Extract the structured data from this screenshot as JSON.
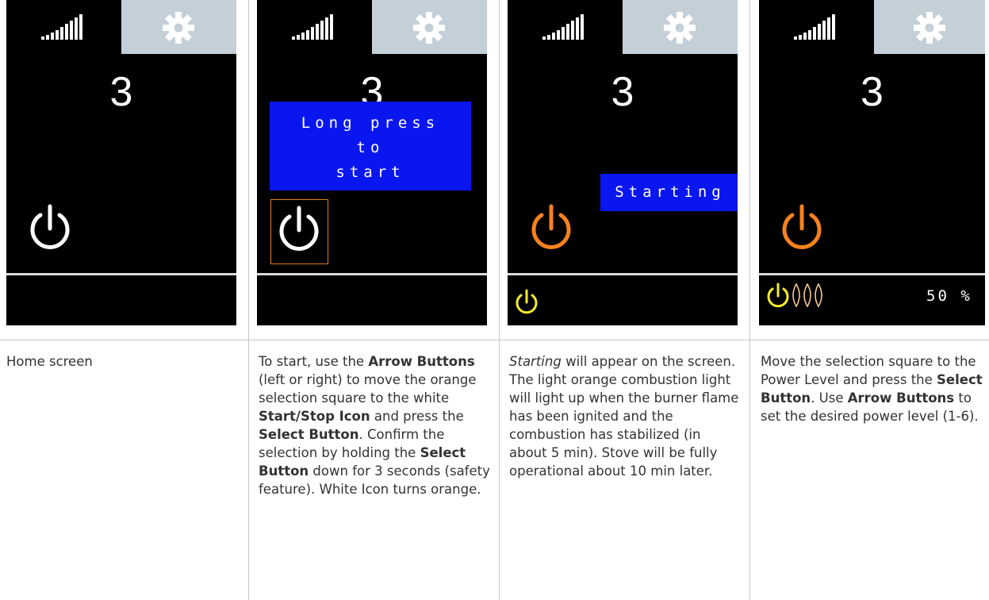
{
  "screens": [
    {
      "level": "3",
      "message": "",
      "power_icon_color": "#ffffff",
      "status_icons": []
    },
    {
      "level": "3",
      "message_lines": [
        "Long press",
        "to",
        "start"
      ],
      "power_icon_color": "#ffffff",
      "selection_color": "#e07e1f"
    },
    {
      "level": "3",
      "message": "Starting",
      "power_icon_color": "#f6821f",
      "status_power_color": "#f7ec2b"
    },
    {
      "level": "3",
      "power_icon_color": "#f6821f",
      "status_power_color": "#f7ec2b",
      "flame_color": "#f3c98f",
      "power_percent": "50 %"
    }
  ],
  "captions": [
    {
      "parts": [
        {
          "text": "Home screen",
          "bold": false,
          "italic": false
        }
      ]
    },
    {
      "parts": [
        {
          "text": "To start, use the ",
          "bold": false
        },
        {
          "text": "Arrow Buttons",
          "bold": true
        },
        {
          "text": " (left or right) to move the orange selection square to the white ",
          "bold": false
        },
        {
          "text": "Start/Stop Icon",
          "bold": true
        },
        {
          "text": " and press the ",
          "bold": false
        },
        {
          "text": "Select Button",
          "bold": true
        },
        {
          "text": ". Confirm the selection by holding the ",
          "bold": false
        },
        {
          "text": "Select Button",
          "bold": true
        },
        {
          "text": " down for 3 seconds (safety feature). White Icon turns orange.",
          "bold": false
        }
      ]
    },
    {
      "parts": [
        {
          "text": "Starting",
          "italic": true
        },
        {
          "text": " will appear on the screen. The light orange combustion light will light up when the burner flame has been ignited and the combustion has stabilized (in about 5 min). Stove will be fully operational about 10 min later.",
          "italic": false
        }
      ]
    },
    {
      "parts": [
        {
          "text": "Move the selection square to the Power Level and press the ",
          "bold": false
        },
        {
          "text": "Select Button",
          "bold": true
        },
        {
          "text": ". Use ",
          "bold": false
        },
        {
          "text": "Arrow Buttons",
          "bold": true
        },
        {
          "text": " to set the desired power level (1-6).",
          "bold": false
        }
      ]
    }
  ]
}
